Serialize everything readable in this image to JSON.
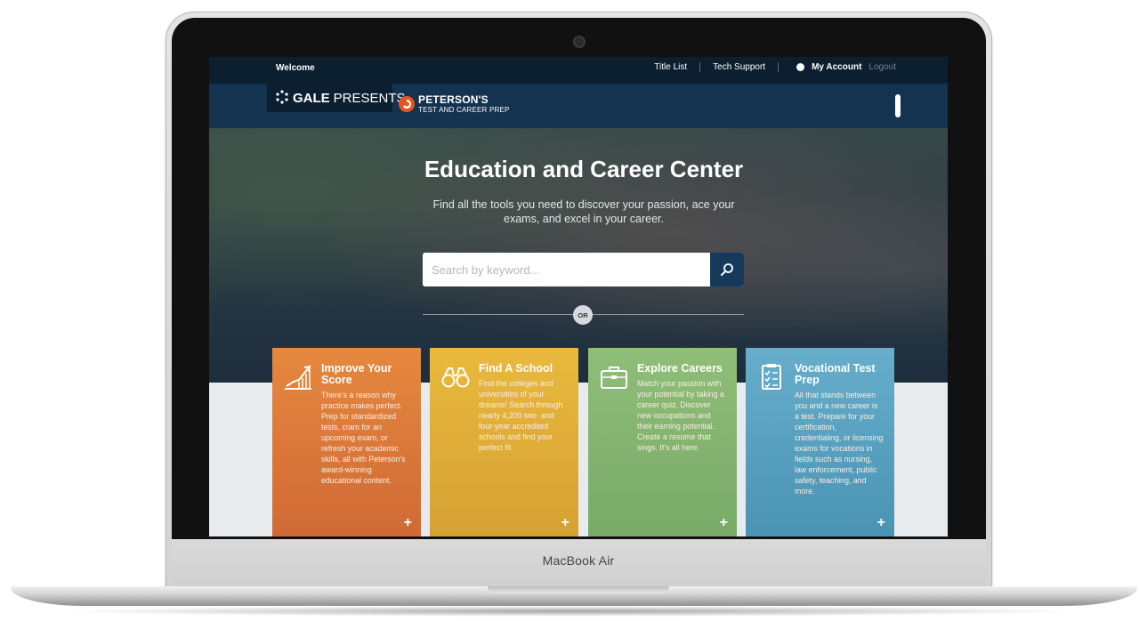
{
  "device": {
    "model_label": "MacBook Air"
  },
  "topbar": {
    "welcome": "Welcome",
    "links": [
      "Title List",
      "Tech Support"
    ],
    "account_label": "My Account",
    "logout_label": "Logout"
  },
  "header": {
    "gale_bold": "GALE",
    "gale_light": "PRESENTS",
    "peterson_name": "PETERSON'S",
    "peterson_sub": "TEST AND CAREER PREP"
  },
  "hero": {
    "title": "Education and Career Center",
    "subtitle": "Find all the tools you need to discover your passion, ace your exams, and excel in your career.",
    "search_placeholder": "Search by keyword...",
    "or_label": "OR"
  },
  "cards": [
    {
      "title": "Improve Your Score",
      "description": "There's a reason why practice makes perfect. Prep for standardized tests, cram for an upcoming exam, or refresh your academic skills, all with Peterson's award-winning educational content.",
      "icon": "chart-growth-icon",
      "color": "#e07c3b"
    },
    {
      "title": "Find A School",
      "description": "Find the colleges and universities of your dreams! Search through nearly 4,200 two- and four-year accredited schools and find your perfect fit.",
      "icon": "binoculars-icon",
      "color": "#e2ae39"
    },
    {
      "title": "Explore Careers",
      "description": "Match your passion with your potential by taking a career quiz. Discover new occupations and their earning potential. Create a resume that sings. It's all here.",
      "icon": "briefcase-icon",
      "color": "#86b673"
    },
    {
      "title": "Vocational Test Prep",
      "description": "All that stands between you and a new career is a test. Prepare for your certification, credentialing, or licensing exams for vocations in fields such as nursing, law enforcement, public safety, teaching, and more.",
      "icon": "checklist-icon",
      "color": "#5aa3c2"
    }
  ],
  "plus_glyph": "+"
}
